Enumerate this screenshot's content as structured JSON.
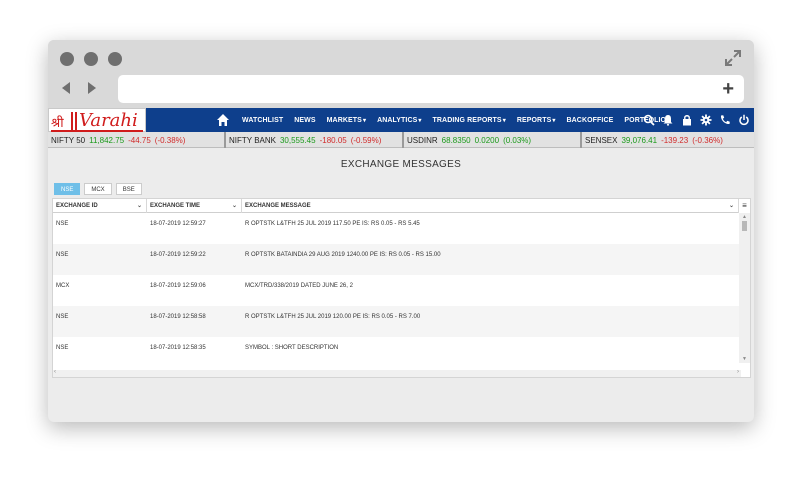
{
  "logo": {
    "shri": "श्री",
    "name": "Varahi"
  },
  "menu": [
    {
      "label": "WATCHLIST",
      "dropdown": false
    },
    {
      "label": "NEWS",
      "dropdown": false
    },
    {
      "label": "MARKETS",
      "dropdown": true
    },
    {
      "label": "ANALYTICS",
      "dropdown": true
    },
    {
      "label": "TRADING REPORTS",
      "dropdown": true
    },
    {
      "label": "REPORTS",
      "dropdown": true
    },
    {
      "label": "BACKOFFICE",
      "dropdown": false
    },
    {
      "label": "PORTFOLIO",
      "dropdown": true
    }
  ],
  "tool_icons": [
    "search-icon",
    "bell-icon",
    "lock-icon",
    "gear-icon",
    "phone-icon",
    "power-icon"
  ],
  "ticker": [
    {
      "name": "NIFTY 50",
      "price": "11,842.75",
      "change": "-44.75",
      "pct": "(-0.38%)",
      "direction": "down"
    },
    {
      "name": "NIFTY BANK",
      "price": "30,555.45",
      "change": "-180.05",
      "pct": "(-0.59%)",
      "direction": "down"
    },
    {
      "name": "USDINR",
      "price": "68.8350",
      "change": "0.0200",
      "pct": "(0.03%)",
      "direction": "up"
    },
    {
      "name": "SENSEX",
      "price": "39,076.41",
      "change": "-139.23",
      "pct": "(-0.36%)",
      "direction": "down"
    }
  ],
  "page_title": "EXCHANGE MESSAGES",
  "tabs": [
    {
      "label": "NSE",
      "active": true
    },
    {
      "label": "MCX",
      "active": false
    },
    {
      "label": "BSE",
      "active": false
    }
  ],
  "columns": [
    "EXCHANGE ID",
    "EXCHANGE TIME",
    "EXCHANGE MESSAGE"
  ],
  "rows": [
    {
      "id": "NSE",
      "time": "18-07-2019 12:59:27",
      "message": "R OPTSTK L&TFH 25 JUL 2019 117.50 PE IS: RS 0.05 - RS 5.45"
    },
    {
      "id": "NSE",
      "time": "18-07-2019 12:59:22",
      "message": "R OPTSTK BATAINDIA 29 AUG 2019 1240.00 PE IS: RS 0.05 - RS 15.00"
    },
    {
      "id": "MCX",
      "time": "18-07-2019 12:59:06",
      "message": "MCX/TRD/338/2019 DATED JUNE 26, 2"
    },
    {
      "id": "NSE",
      "time": "18-07-2019 12:58:58",
      "message": "R OPTSTK L&TFH 25 JUL 2019 120.00 PE IS: RS 0.05 - RS 7.00"
    },
    {
      "id": "NSE",
      "time": "18-07-2019 12:58:35",
      "message": "SYMBOL : SHORT DESCRIPTION"
    }
  ],
  "colors": {
    "nav": "#0e3f8c",
    "accent_tab": "#6fbfe8",
    "up": "#1a9a1a",
    "down": "#d12b2b",
    "logo_red": "#d01c1c"
  }
}
